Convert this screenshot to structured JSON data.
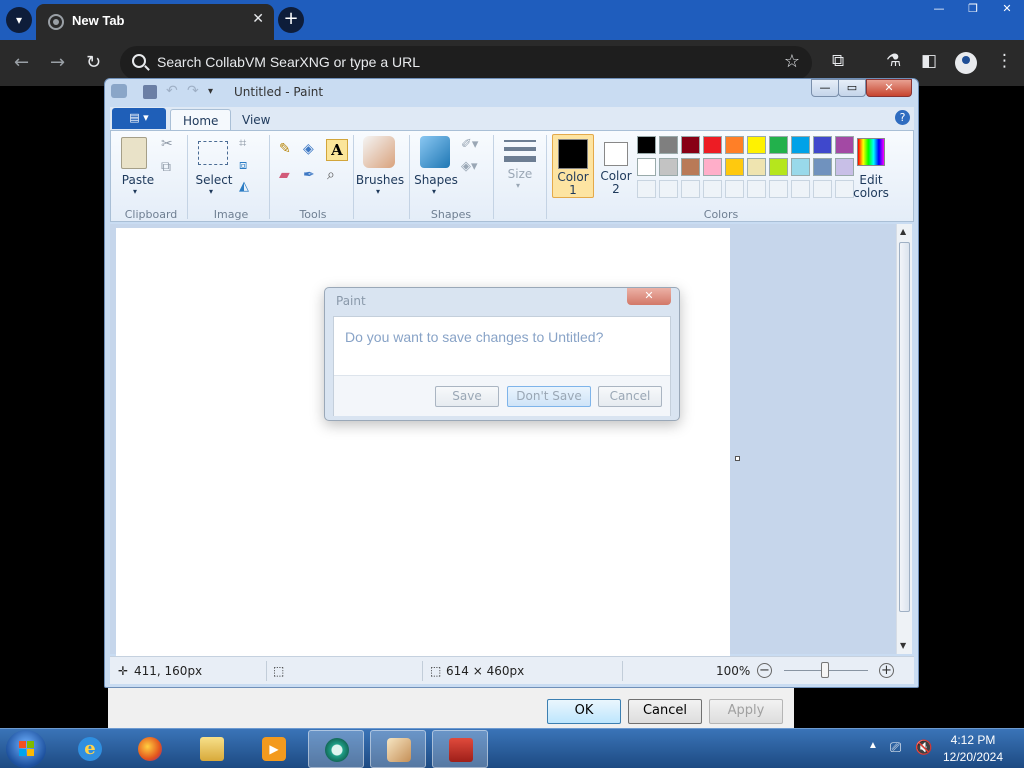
{
  "browser": {
    "tab_title": "New Tab",
    "tab_close": "✕",
    "new_tab": "+",
    "omnibox_placeholder": "Search CollabVM SearXNG or type a URL",
    "window_controls": [
      "—",
      "❐",
      "✕"
    ]
  },
  "paint": {
    "window_title": "Untitled - Paint",
    "tabs": {
      "home": "Home",
      "view": "View"
    },
    "help": "?",
    "groups": {
      "clipboard": {
        "label": "Clipboard",
        "paste": "Paste"
      },
      "image": {
        "label": "Image",
        "select": "Select"
      },
      "tools": {
        "label": "Tools"
      },
      "brushes": {
        "label": "Brushes"
      },
      "shapes": {
        "label": "Shapes",
        "shapes_btn": "Shapes"
      },
      "size": {
        "label": "Size"
      },
      "colors": {
        "label": "Colors",
        "color1_line1": "Color",
        "color1_line2": "1",
        "color2_line1": "Color",
        "color2_line2": "2",
        "edit_line1": "Edit",
        "edit_line2": "colors",
        "palette_row1": [
          "#000000",
          "#7f7f7f",
          "#880015",
          "#ed1c24",
          "#ff7f27",
          "#fff200",
          "#22b14c",
          "#00a2e8",
          "#3f48cc",
          "#a349a4"
        ],
        "palette_row2": [
          "#ffffff",
          "#c3c3c3",
          "#b97a57",
          "#ffaec9",
          "#ffc90e",
          "#efe4b0",
          "#b5e61d",
          "#99d9ea",
          "#7092be",
          "#c8bfe7"
        ],
        "color1_value": "#000000",
        "color2_value": "#ffffff"
      }
    },
    "status": {
      "cursor_pos": "411, 160px",
      "image_size": "614 × 460px",
      "zoom": "100%"
    }
  },
  "save_dialog": {
    "title": "Paint",
    "close": "✕",
    "message": "Do you want to save changes to Untitled?",
    "buttons": {
      "save": "Save",
      "dont_save": "Don't Save",
      "cancel": "Cancel"
    }
  },
  "background_dialog": {
    "buttons": {
      "ok": "OK",
      "cancel": "Cancel",
      "apply": "Apply"
    }
  },
  "taskbar": {
    "time": "4:12 PM",
    "date": "12/20/2024"
  }
}
